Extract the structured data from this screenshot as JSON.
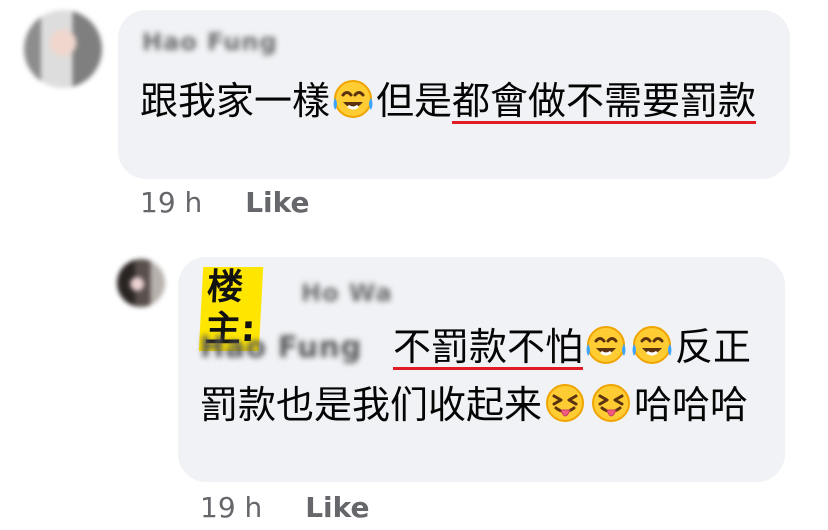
{
  "comments": [
    {
      "author": "Hao Fung",
      "text_before": "跟我家一樣",
      "emoji_1": "😂",
      "text_middle": "但是",
      "underlined_text": "都會做不需要罰款",
      "time": "19 h",
      "like_label": "Like"
    },
    {
      "owner_label": "楼主:",
      "author": "Ho Wa",
      "mention": "Hao Fung",
      "underlined_text": "不罰款不怕",
      "emoji_1": "😂",
      "emoji_2": "😂",
      "text_after_emojis": "反正罰款也是我们收起来",
      "emoji_3": "😝",
      "emoji_4": "😝",
      "text_end": "哈哈哈",
      "time": "19 h",
      "like_label": "Like"
    }
  ],
  "colors": {
    "bubble": "#f0f2f5",
    "meta_text": "#65676b",
    "underline": "#e21c24",
    "owner_highlight": "#ffe600"
  },
  "icons": {
    "laughing_face": "tears-of-joy-emoji",
    "tongue_face": "squinting-tongue-emoji"
  }
}
